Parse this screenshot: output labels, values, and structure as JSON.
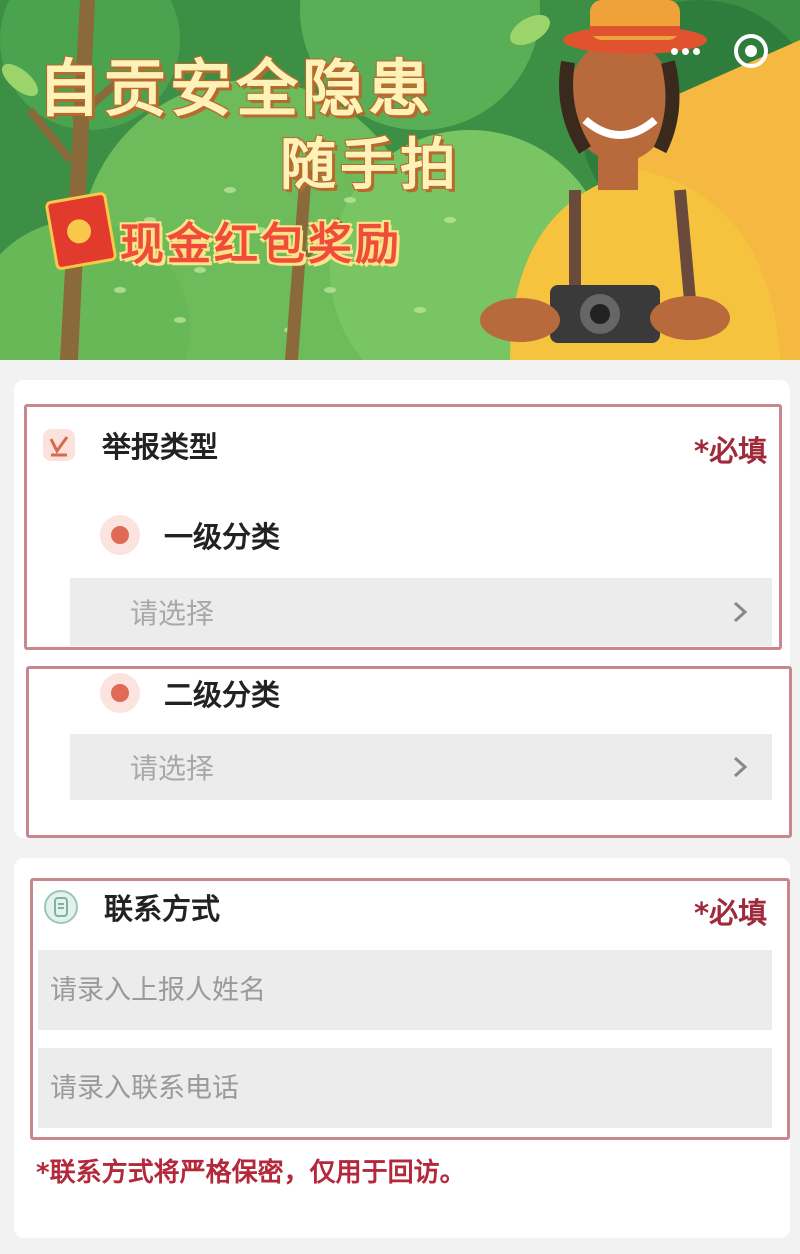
{
  "banner": {
    "title": "自贡安全隐患",
    "subtitle": "随手拍",
    "reward": "现金红包奖励"
  },
  "report_type": {
    "title": "举报类型",
    "required": "*必填",
    "level1": {
      "label": "一级分类",
      "placeholder": "请选择"
    },
    "level2": {
      "label": "二级分类",
      "placeholder": "请选择"
    }
  },
  "contact": {
    "title": "联系方式",
    "required": "*必填",
    "name_placeholder": "请录入上报人姓名",
    "phone_placeholder": "请录入联系电话",
    "note": "*联系方式将严格保密，仅用于回访。"
  },
  "colors": {
    "required_text": "#9e2a3b",
    "frame": "#c9868c",
    "dot": "#e06a56"
  }
}
